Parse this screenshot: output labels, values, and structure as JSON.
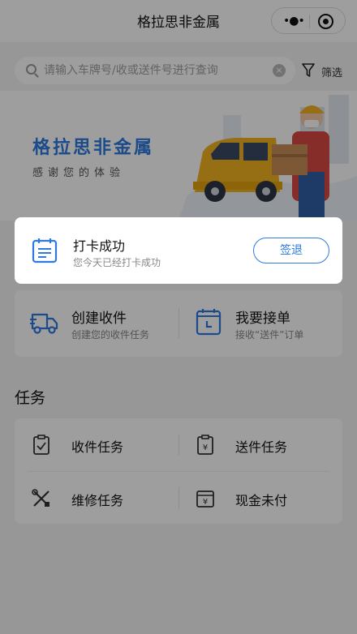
{
  "navbar": {
    "title": "格拉思非金属",
    "menu_icon": "more-dots-icon",
    "close_icon": "target-icon"
  },
  "search": {
    "placeholder": "请输入车牌号/收或送件号进行查询",
    "value": "",
    "clear_icon": "clear-icon"
  },
  "filter": {
    "label": "筛选",
    "icon": "funnel-icon"
  },
  "banner": {
    "title": "格拉思非金属",
    "subtitle": "感谢您的体验"
  },
  "checkin": {
    "title": "打卡成功",
    "subtitle": "您今天已经打卡成功",
    "button": "签退",
    "icon": "calendar-icon"
  },
  "actions": [
    {
      "title": "创建收件",
      "subtitle": "创建您的收件任务",
      "icon": "delivery-truck-icon"
    },
    {
      "title": "我要接单",
      "subtitle": "接收“送件”订单",
      "icon": "calendar-clock-icon"
    }
  ],
  "tasks_section": {
    "title": "任务"
  },
  "tasks": [
    {
      "label": "收件任务",
      "icon": "clipboard-check-icon"
    },
    {
      "label": "送件任务",
      "icon": "clipboard-yen-icon"
    },
    {
      "label": "维修任务",
      "icon": "tools-icon"
    },
    {
      "label": "现金未付",
      "icon": "yen-box-icon"
    }
  ],
  "colors": {
    "accent": "#2e7ae0",
    "overlay": "rgba(0,0,0,0.38)"
  }
}
